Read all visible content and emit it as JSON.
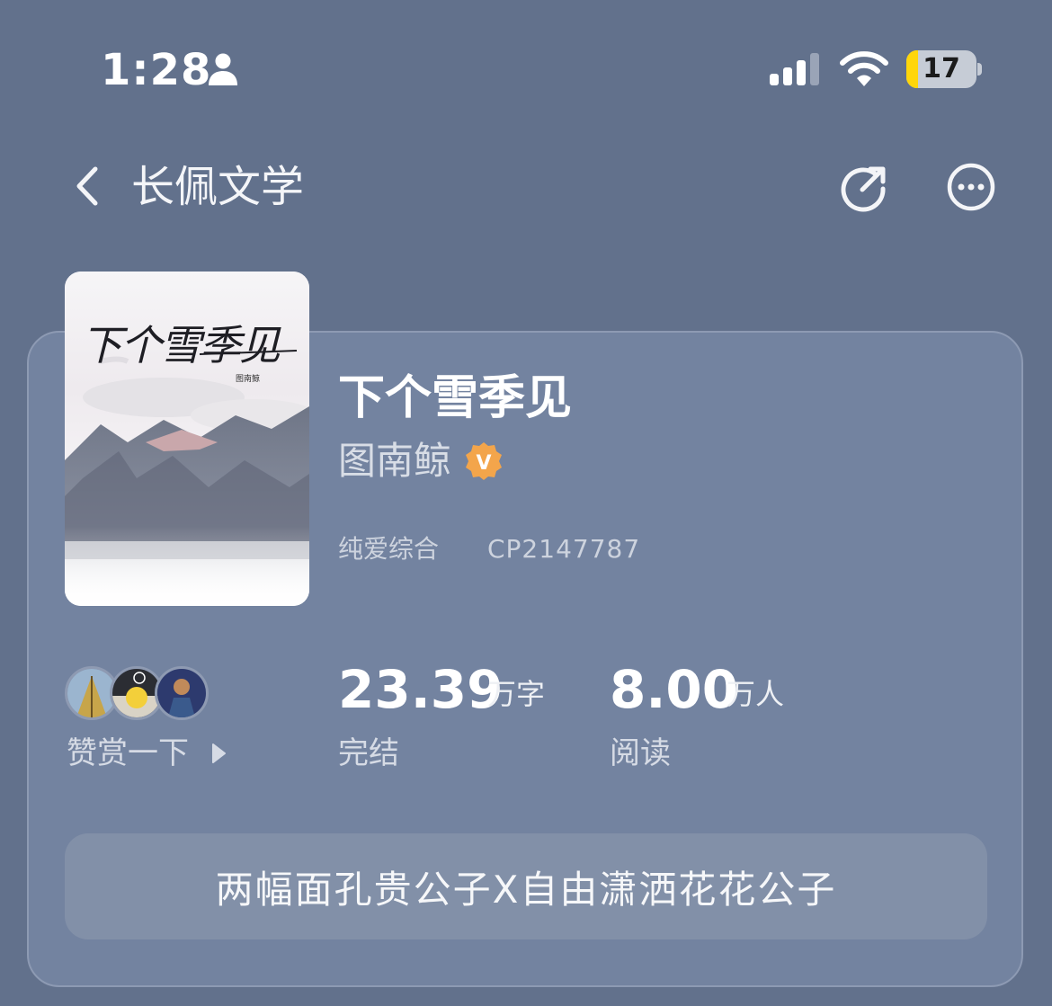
{
  "status_bar": {
    "time": "1:28",
    "battery_level": "17",
    "battery_fraction": 0.17
  },
  "nav": {
    "title": "长佩文学",
    "icons": [
      "back-icon",
      "share-icon",
      "more-icon"
    ]
  },
  "book": {
    "cover_title": "下个雪季见",
    "cover_author": "图南鲸",
    "title": "下个雪季见",
    "author": "图南鲸",
    "author_badge": "V",
    "genre": "纯爱综合",
    "cp_id": "CP2147787"
  },
  "supporters": {
    "label": "赞赏一下",
    "avatar_count": 3
  },
  "stats": {
    "words_value": "23.39",
    "words_unit": "万字",
    "status_label": "完结",
    "reads_value": "8.00",
    "reads_unit": "万人",
    "reads_label": "阅读"
  },
  "tagline": "两幅面孔贵公子X自由潇洒花花公子",
  "colors": {
    "background": "#62718c",
    "card": "#7383a0",
    "badge": "#f3a54b",
    "battery_fill": "#ffd60a"
  }
}
